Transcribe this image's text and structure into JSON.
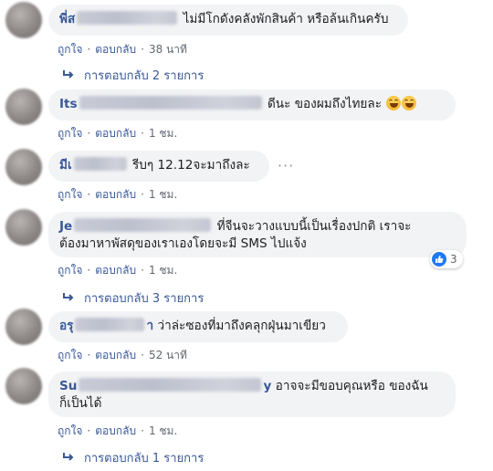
{
  "actions": {
    "like": "ถูกใจ",
    "reply": "ตอบกลับ",
    "separator": "·"
  },
  "comments": [
    {
      "author_visible": "พี่ส",
      "text": "ไม่มีโกดังคลังพักสินค้า หรือล้นเกินครับ",
      "time": "38 นาที",
      "replies_label": "การตอบกลับ 2 รายการ"
    },
    {
      "author_visible": "Its",
      "text": "ดีนะ ของผมถึงไทยละ",
      "emoji": [
        "grinning-sweat-emoji",
        "grinning-sweat-emoji"
      ],
      "time": "1 ชม."
    },
    {
      "author_visible": "มีเ",
      "text": "รีบๆ 12.12จะมาถึงละ",
      "more": "···",
      "time": "1 ชม."
    },
    {
      "author_visible": "Je",
      "text_line1": "ที่จีนจะวางแบบนี้เป็นเรื่องปกติ เราจะ",
      "text_line2": "ต้องมาหาพัสดุของเราเองโดยจะมี SMS ไปแจ้ง",
      "time": "1 ชม.",
      "reaction_count": "3",
      "replies_label": "การตอบกลับ 3 รายการ"
    },
    {
      "author_visible": "อรุ",
      "author_tail": "า",
      "text": "ว่าล่ะซองที่มาถึงคลุกฝุ่นมาเขียว",
      "time": "52 นาที"
    },
    {
      "author_visible": "Su",
      "author_tail": "y",
      "text_line1": "อาจจะมีขอบคุณหรือ ของฉัน",
      "text_line2": "ก็เป็นได้",
      "time": "1 ชม.",
      "replies_label": "การตอบกลับ 1 รายการ"
    }
  ],
  "colors": {
    "link": "#385898",
    "bubble": "#f2f3f5",
    "meta": "#606770",
    "like_blue": "#2078f4"
  }
}
